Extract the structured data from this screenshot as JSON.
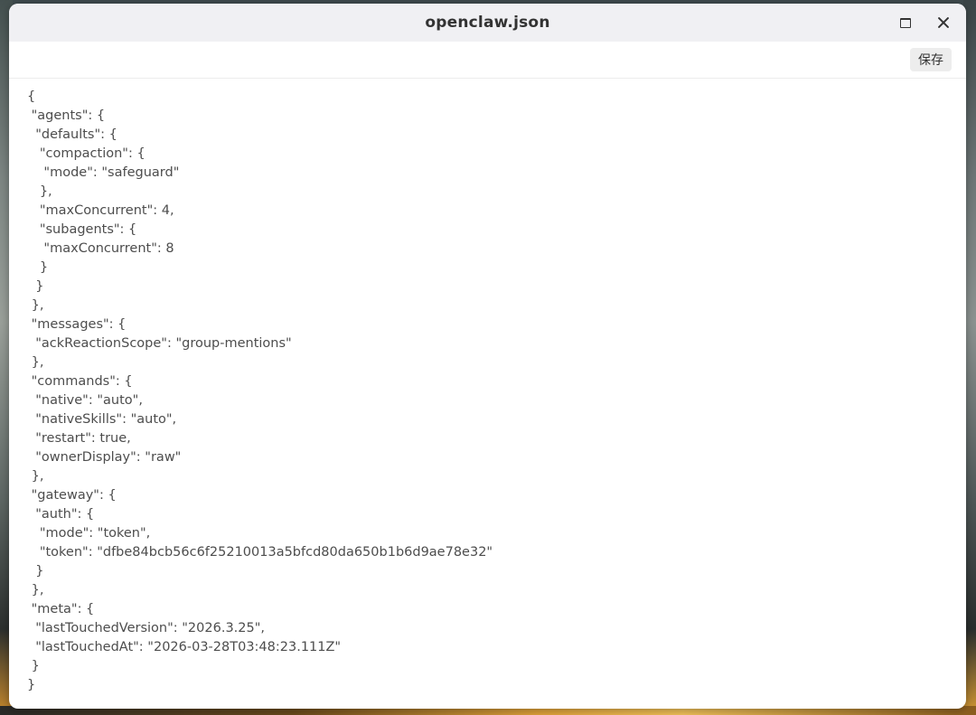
{
  "window": {
    "title": "openclaw.json",
    "maximize_icon": "maximize-icon",
    "close_icon": "close-icon"
  },
  "toolbar": {
    "save_label": "保存"
  },
  "editor": {
    "lines": [
      "{",
      " \"agents\": {",
      "  \"defaults\": {",
      "   \"compaction\": {",
      "    \"mode\": \"safeguard\"",
      "   },",
      "   \"maxConcurrent\": 4,",
      "   \"subagents\": {",
      "    \"maxConcurrent\": 8",
      "   }",
      "  }",
      " },",
      " \"messages\": {",
      "  \"ackReactionScope\": \"group-mentions\"",
      " },",
      " \"commands\": {",
      "  \"native\": \"auto\",",
      "  \"nativeSkills\": \"auto\",",
      "  \"restart\": true,",
      "  \"ownerDisplay\": \"raw\"",
      " },",
      " \"gateway\": {",
      "  \"auth\": {",
      "   \"mode\": \"token\",",
      "   \"token\": \"dfbe84bcb56c6f25210013a5bfcd80da650b1b6d9ae78e32\"",
      "  }",
      " },",
      " \"meta\": {",
      "  \"lastTouchedVersion\": \"2026.3.25\",",
      "  \"lastTouchedAt\": \"2026-03-28T03:48:23.111Z\"",
      " }",
      "}"
    ]
  }
}
